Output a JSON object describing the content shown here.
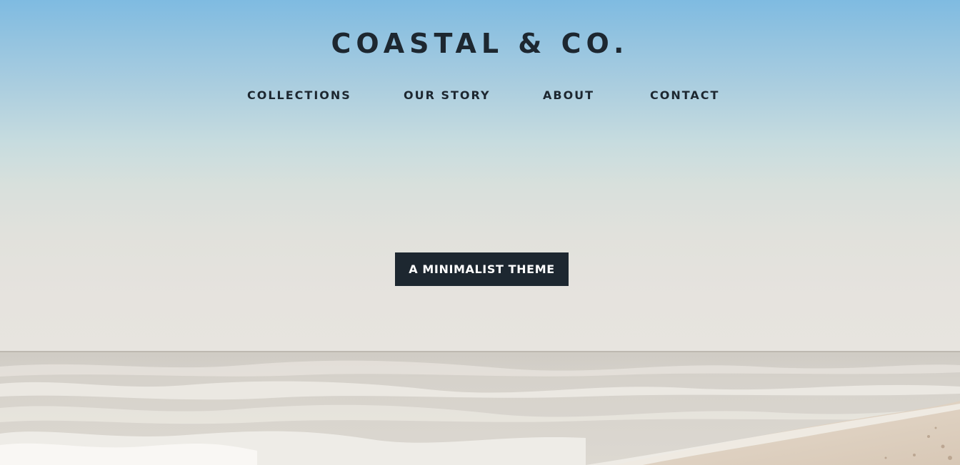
{
  "brand": {
    "name": "COASTAL & CO."
  },
  "nav": {
    "items": [
      {
        "label": "COLLECTIONS"
      },
      {
        "label": "OUR STORY"
      },
      {
        "label": "ABOUT"
      },
      {
        "label": "CONTACT"
      }
    ]
  },
  "hero": {
    "cta_label": "A MINIMALIST THEME",
    "image": "beach-shoreline-photo"
  },
  "colors": {
    "sky_top": "#7fbbe1",
    "haze": "#e6e3de",
    "text_dark": "#1d2730",
    "button_bg": "#1d2730",
    "button_text": "#ffffff"
  }
}
